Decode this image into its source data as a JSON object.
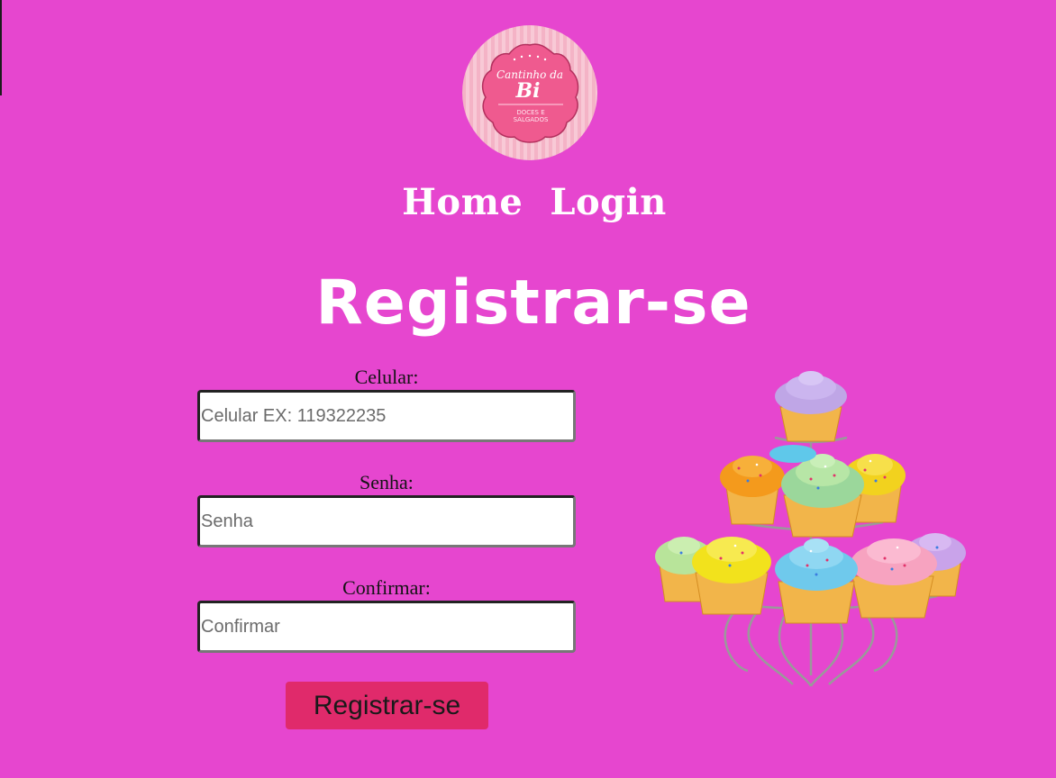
{
  "logo": {
    "line1": "Cantinho da",
    "line2": "Bi",
    "line3": "DOCES E",
    "line4": "SALGADOS"
  },
  "nav": {
    "home": "Home",
    "login": "Login"
  },
  "page": {
    "title": "Registrar-se"
  },
  "form": {
    "celular": {
      "label": "Celular:",
      "placeholder": "Celular EX: 119322235",
      "value": ""
    },
    "senha": {
      "label": "Senha:",
      "placeholder": "Senha",
      "value": ""
    },
    "confirmar": {
      "label": "Confirmar:",
      "placeholder": "Confirmar",
      "value": ""
    },
    "submit_label": "Registrar-se"
  },
  "colors": {
    "background": "#e646cf",
    "button": "#e02a6b",
    "logo_pink": "#ef5a8f"
  },
  "image": {
    "name": "cupcake-stand-image"
  }
}
